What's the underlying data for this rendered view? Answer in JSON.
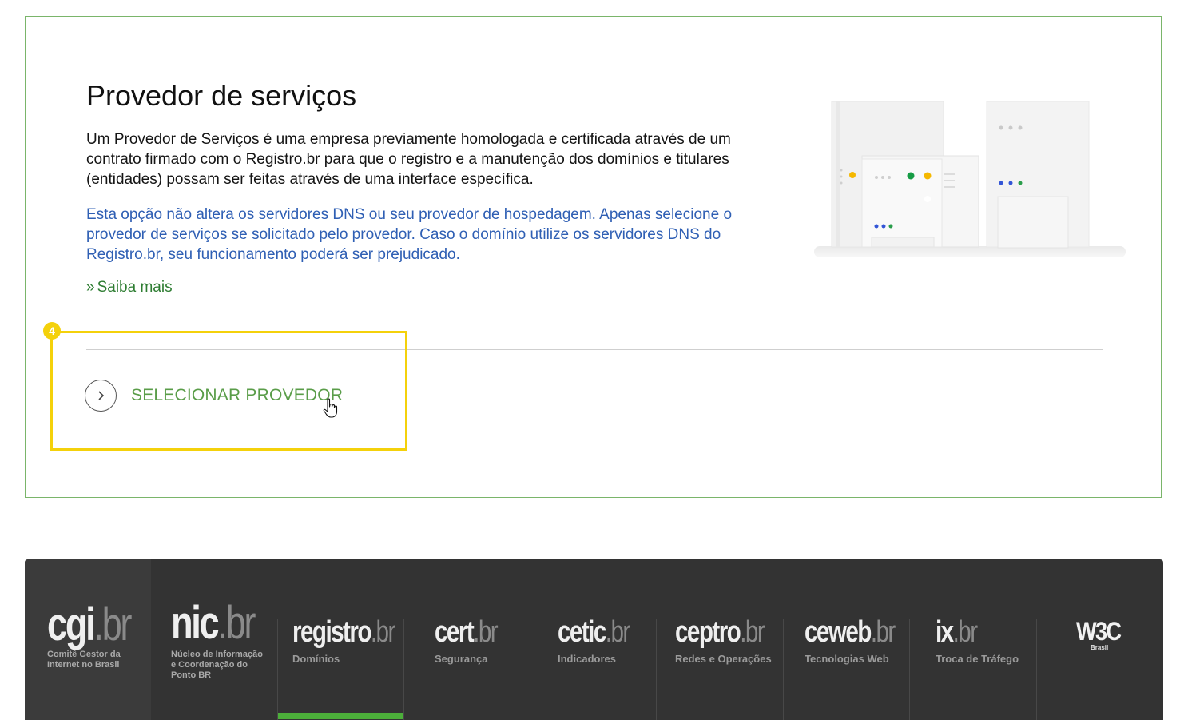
{
  "card": {
    "title": "Provedor de serviços",
    "description": "Um Provedor de Serviços é uma empresa previamente homologada e certificada através de um contrato firmado com o Registro.br para que o registro e a manutenção dos domínios e titulares (entidades) possam ser feitas através de uma interface específica.",
    "note": "Esta opção não altera os servidores DNS ou seu provedor de hospedagem. Apenas selecione o provedor de serviços se solicitado pelo provedor. Caso o domínio utilize os servidores DNS do Registro.br, seu funcionamento poderá ser prejudicado.",
    "learn_more_prefix": "»",
    "learn_more": "Saiba mais",
    "select_button": "SELECIONAR PROVEDOR",
    "step_badge": "4",
    "highlight_color": "#f4d10b",
    "accent_color": "#5a9d49"
  },
  "footer": {
    "active_color": "#4caf3a",
    "brands": [
      {
        "name": "cgi",
        "suffix": ".br",
        "subtitle_lines": [
          "Comitê Gestor da",
          "Internet no Brasil"
        ]
      },
      {
        "name": "nic",
        "suffix": ".br",
        "subtitle_lines": [
          "Núcleo de Informação",
          "e Coordenação do",
          "Ponto BR"
        ]
      },
      {
        "name": "registro",
        "suffix": ".br",
        "subtitle": "Domínios"
      },
      {
        "name": "cert",
        "suffix": ".br",
        "subtitle": "Segurança"
      },
      {
        "name": "cetic",
        "suffix": ".br",
        "subtitle": "Indicadores"
      },
      {
        "name": "ceptro",
        "suffix": ".br",
        "subtitle": "Redes e Operações"
      },
      {
        "name": "ceweb",
        "suffix": ".br",
        "subtitle": "Tecnologias Web"
      },
      {
        "name": "ix",
        "suffix": ".br",
        "subtitle": "Troca de Tráfego"
      },
      {
        "name": "W3C",
        "subtitle": "Brasil"
      }
    ]
  }
}
